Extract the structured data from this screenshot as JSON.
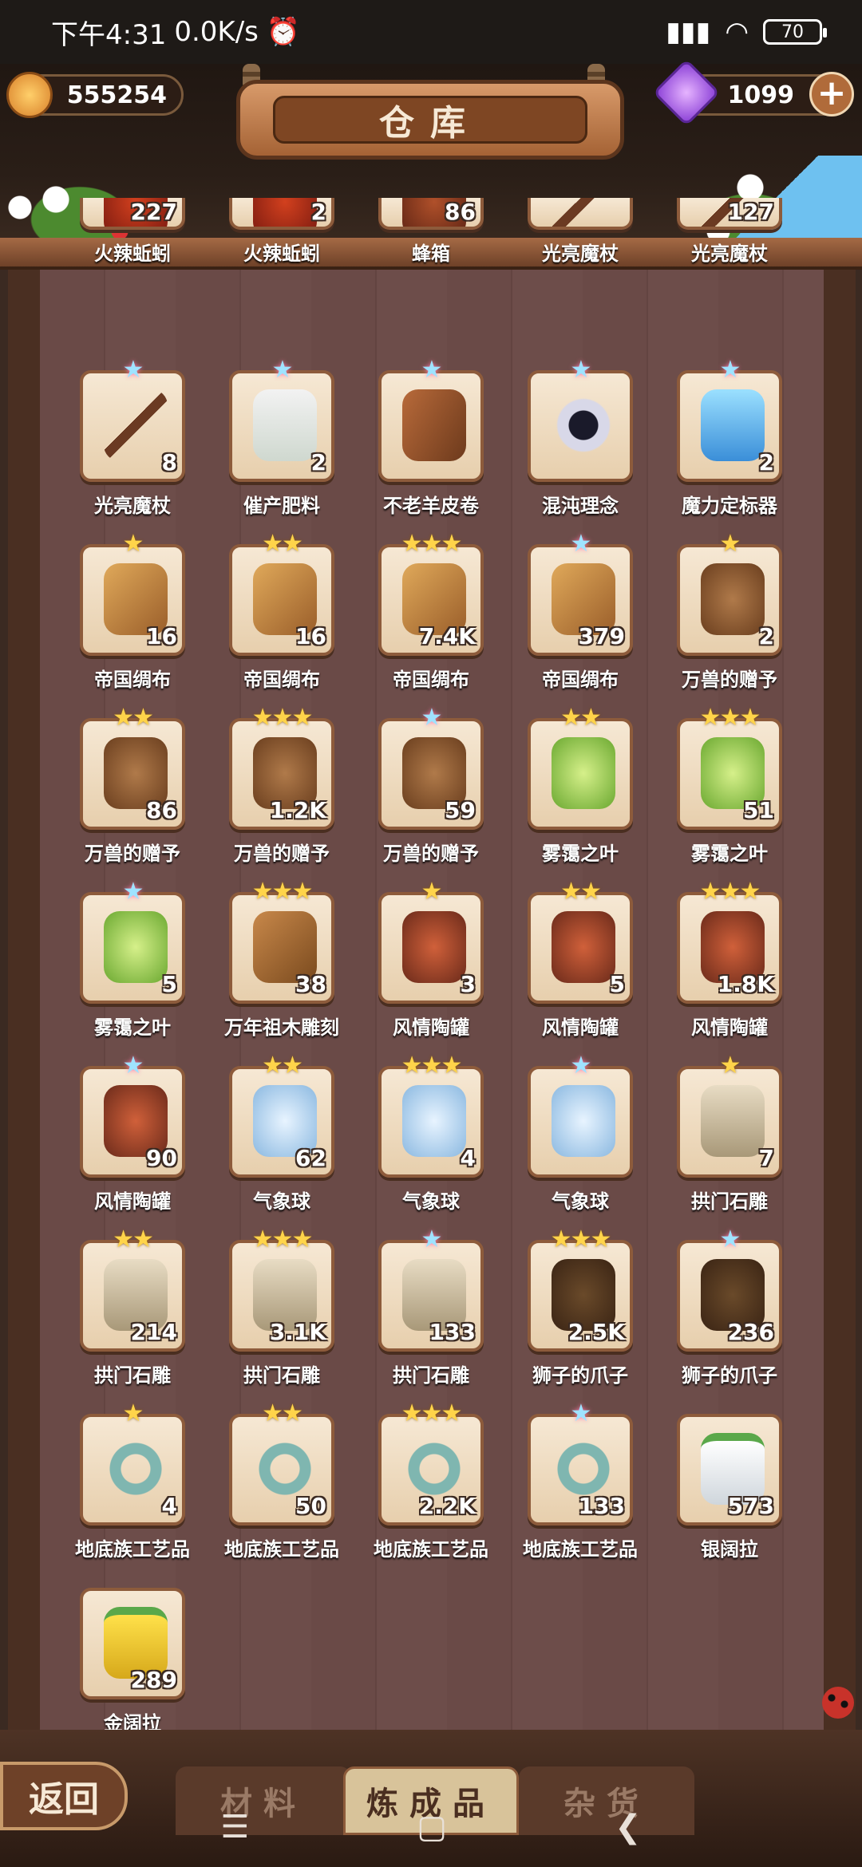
{
  "status_bar": {
    "time": "下午4:31",
    "speed": "0.0K/s",
    "battery": "70"
  },
  "header": {
    "title": "仓库",
    "coins": "555254",
    "gems": "1099",
    "plus": "+"
  },
  "items": [
    {
      "name": "火辣蚯蚓",
      "count": "227",
      "stars": "",
      "icon": "pepper"
    },
    {
      "name": "火辣蚯蚓",
      "count": "2",
      "stars": "",
      "icon": "pepper"
    },
    {
      "name": "蜂箱",
      "count": "86",
      "stars": "",
      "icon": "hive"
    },
    {
      "name": "光亮魔杖",
      "count": "",
      "stars": "",
      "icon": "wand"
    },
    {
      "name": "光亮魔杖",
      "count": "127",
      "stars": "",
      "icon": "wand"
    },
    {
      "name": "光亮魔杖",
      "count": "8",
      "stars": "★",
      "icon": "wand",
      "rainbow": true
    },
    {
      "name": "催产肥料",
      "count": "2",
      "stars": "★",
      "icon": "bag",
      "rainbow": true
    },
    {
      "name": "不老羊皮卷",
      "count": "",
      "stars": "★",
      "icon": "parchment",
      "rainbow": true
    },
    {
      "name": "混沌理念",
      "count": "",
      "stars": "★",
      "icon": "portal",
      "rainbow": true
    },
    {
      "name": "魔力定标器",
      "count": "2",
      "stars": "★",
      "icon": "flask",
      "rainbow": true
    },
    {
      "name": "帝国绸布",
      "count": "16",
      "stars": "★",
      "icon": "silk"
    },
    {
      "name": "帝国绸布",
      "count": "16",
      "stars": "★★",
      "icon": "silk"
    },
    {
      "name": "帝国绸布",
      "count": "7.4K",
      "stars": "★★★",
      "icon": "silk"
    },
    {
      "name": "帝国绸布",
      "count": "379",
      "stars": "★",
      "icon": "silk",
      "rainbow": true
    },
    {
      "name": "万兽的赠予",
      "count": "2",
      "stars": "★",
      "icon": "pendant"
    },
    {
      "name": "万兽的赠予",
      "count": "86",
      "stars": "★★",
      "icon": "pendant"
    },
    {
      "name": "万兽的赠予",
      "count": "1.2K",
      "stars": "★★★",
      "icon": "pendant"
    },
    {
      "name": "万兽的赠予",
      "count": "59",
      "stars": "★",
      "icon": "pendant",
      "rainbow": true
    },
    {
      "name": "雾霭之叶",
      "count": "",
      "stars": "★★",
      "icon": "leaf"
    },
    {
      "name": "雾霭之叶",
      "count": "51",
      "stars": "★★★",
      "icon": "leaf"
    },
    {
      "name": "雾霭之叶",
      "count": "5",
      "stars": "★",
      "icon": "leaf",
      "rainbow": true
    },
    {
      "name": "万年祖木雕刻",
      "count": "38",
      "stars": "★★★",
      "icon": "wing"
    },
    {
      "name": "风情陶罐",
      "count": "3",
      "stars": "★",
      "icon": "jar"
    },
    {
      "name": "风情陶罐",
      "count": "5",
      "stars": "★★",
      "icon": "jar"
    },
    {
      "name": "风情陶罐",
      "count": "1.8K",
      "stars": "★★★",
      "icon": "jar"
    },
    {
      "name": "风情陶罐",
      "count": "90",
      "stars": "★",
      "icon": "jar",
      "rainbow": true
    },
    {
      "name": "气象球",
      "count": "62",
      "stars": "★★",
      "icon": "balloon"
    },
    {
      "name": "气象球",
      "count": "4",
      "stars": "★★★",
      "icon": "balloon"
    },
    {
      "name": "气象球",
      "count": "",
      "stars": "★",
      "icon": "balloon",
      "rainbow": true
    },
    {
      "name": "拱门石雕",
      "count": "7",
      "stars": "★",
      "icon": "arch"
    },
    {
      "name": "拱门石雕",
      "count": "214",
      "stars": "★★",
      "icon": "arch"
    },
    {
      "name": "拱门石雕",
      "count": "3.1K",
      "stars": "★★★",
      "icon": "arch"
    },
    {
      "name": "拱门石雕",
      "count": "133",
      "stars": "★",
      "icon": "arch",
      "rainbow": true
    },
    {
      "name": "狮子的爪子",
      "count": "2.5K",
      "stars": "★★★",
      "icon": "paw"
    },
    {
      "name": "狮子的爪子",
      "count": "236",
      "stars": "★",
      "icon": "paw",
      "rainbow": true
    },
    {
      "name": "地底族工艺品",
      "count": "4",
      "stars": "★",
      "icon": "knot"
    },
    {
      "name": "地底族工艺品",
      "count": "50",
      "stars": "★★",
      "icon": "knot"
    },
    {
      "name": "地底族工艺品",
      "count": "2.2K",
      "stars": "★★★",
      "icon": "knot"
    },
    {
      "name": "地底族工艺品",
      "count": "133",
      "stars": "★",
      "icon": "knot",
      "rainbow": true
    },
    {
      "name": "银阔拉",
      "count": "573",
      "stars": "",
      "icon": "bag-white"
    },
    {
      "name": "金阔拉",
      "count": "289",
      "stars": "",
      "icon": "bag-yellow"
    }
  ],
  "tabs": [
    {
      "label": "材料",
      "active": false
    },
    {
      "label": "炼成品",
      "active": true
    },
    {
      "label": "杂货",
      "active": false
    }
  ],
  "back_label": "返回",
  "nav": {
    "menu": "☰",
    "home": "▢",
    "back": "❮"
  }
}
